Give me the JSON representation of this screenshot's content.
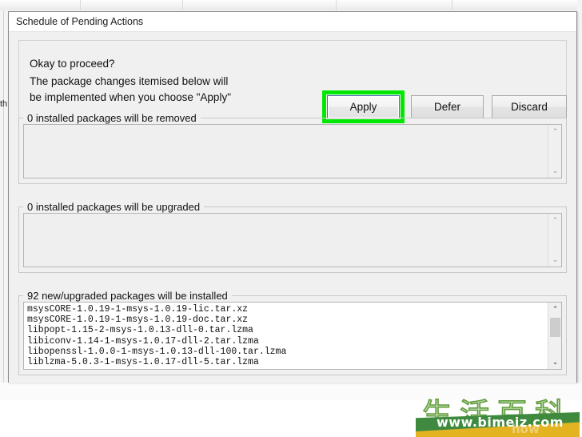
{
  "background": {
    "left_edge_text": "th",
    "tab_divider_positions": [
      100,
      228,
      420,
      565,
      725
    ]
  },
  "dialog": {
    "title": "Schedule of Pending Actions",
    "prompt": {
      "question": "Okay to proceed?",
      "line1": "The package changes itemised below will",
      "line2": "be implemented when you choose \"Apply\""
    },
    "buttons": [
      {
        "label": "Apply",
        "name": "apply-button",
        "highlighted": true
      },
      {
        "label": "Defer",
        "name": "defer-button",
        "highlighted": false
      },
      {
        "label": "Discard",
        "name": "discard-button",
        "highlighted": false
      }
    ],
    "highlight_color": "#00e800",
    "sections": [
      {
        "label": "0 installed packages will be removed",
        "items": [],
        "text": ""
      },
      {
        "label": "0 installed packages will be upgraded",
        "items": [],
        "text": ""
      },
      {
        "label": "92 new/upgraded packages will be installed",
        "items": [
          "msysCORE-1.0.19-1-msys-1.0.19-lic.tar.xz",
          "msysCORE-1.0.19-1-msys-1.0.19-doc.tar.xz",
          "libpopt-1.15-2-msys-1.0.13-dll-0.tar.lzma",
          "libiconv-1.14-1-msys-1.0.17-dll-2.tar.lzma",
          "libopenssl-1.0.0-1-msys-1.0.13-dll-100.tar.lzma",
          "liblzma-5.0.3-1-msys-1.0.17-dll-5.tar.lzma"
        ],
        "text": "msysCORE-1.0.19-1-msys-1.0.19-lic.tar.xz\nmsysCORE-1.0.19-1-msys-1.0.19-doc.tar.xz\nlibpopt-1.15-2-msys-1.0.13-dll-0.tar.lzma\nlibiconv-1.14-1-msys-1.0.17-dll-2.tar.lzma\nlibopenssl-1.0.0-1-msys-1.0.13-dll-100.tar.lzma\nliblzma-5.0.3-1-msys-1.0.17-dll-5.tar.lzma"
      }
    ],
    "scrollbar": {
      "up_arrow": "⌃",
      "down_arrow": "⌄"
    }
  },
  "watermark": {
    "cjk": "生活百科",
    "url": "www.bimeiz.com",
    "ghost": "how",
    "stroke_color": "#5f9d3a",
    "band_green": "#3f8a3f",
    "band_yellow": "#e3b322"
  }
}
